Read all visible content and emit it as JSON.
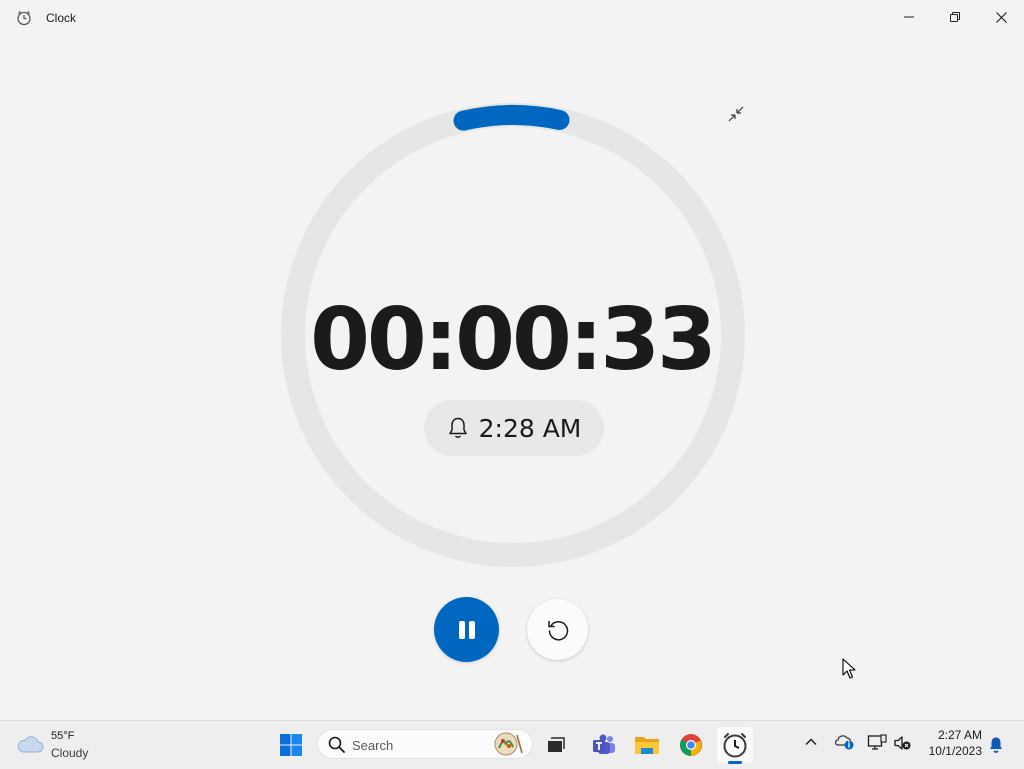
{
  "window": {
    "title": "Clock",
    "minimize_icon": "minimize-icon",
    "maximize_icon": "restore-icon",
    "close_icon": "close-icon"
  },
  "timer": {
    "time": "00:00:33",
    "progress_fraction": 0.07,
    "alarm_icon": "bell-icon",
    "alarm_time": "2:28 AM",
    "compact_icon": "compact-overlay-icon",
    "pause_icon": "pause-icon",
    "reset_icon": "reset-icon"
  },
  "colors": {
    "accent": "#0067c0",
    "ring_track": "#e6e6e6",
    "background": "#f3f3f3"
  },
  "taskbar": {
    "weather": {
      "temp": "55°F",
      "condition": "Cloudy",
      "icon": "cloud-icon"
    },
    "search_placeholder": "Search",
    "apps": [
      "start-icon",
      "task-view-icon",
      "teams-icon",
      "file-explorer-icon",
      "chrome-icon",
      "clock-app-icon"
    ],
    "tray": {
      "time": "2:27 AM",
      "date": "10/1/2023"
    }
  }
}
